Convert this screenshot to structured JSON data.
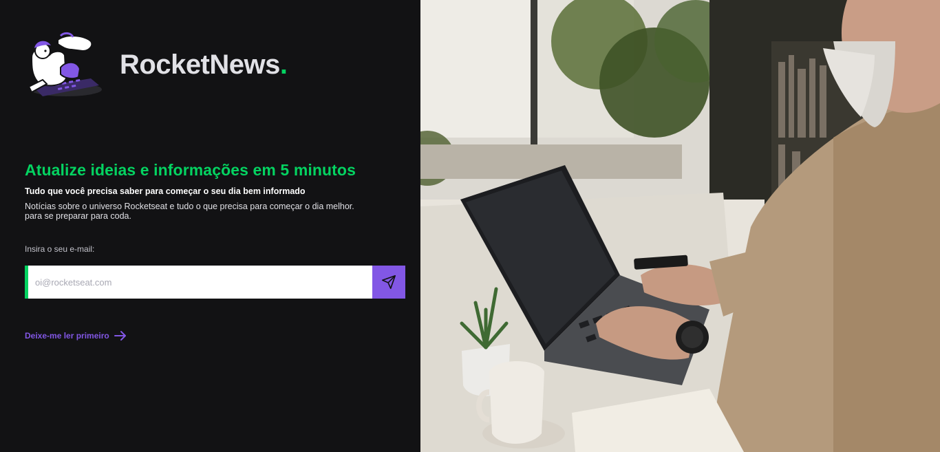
{
  "brand": {
    "name": "RocketNews",
    "dot": "."
  },
  "hero": {
    "headline": "Atualize ideias e informações em 5 minutos",
    "subtitle": "Tudo que você precisa saber para começar o seu dia bem informado",
    "description_line1": "Notícias sobre o universo Rocketseat e tudo o que precisa para começar o dia melhor.",
    "description_line2": "para se preparar para coda."
  },
  "form": {
    "label": "Insira o seu e-mail:",
    "email_placeholder": "oi@rocketseat.com",
    "submit_icon": "send-icon"
  },
  "link": {
    "read_first": "Deixe-me ler primeiro",
    "icon": "arrow-right-icon"
  },
  "colors": {
    "background": "#121214",
    "accent_green": "#04d361",
    "accent_purple": "#8257e5",
    "text_light": "#e1e1e6"
  },
  "image": {
    "subject": "man-typing-on-laptop-photo"
  }
}
